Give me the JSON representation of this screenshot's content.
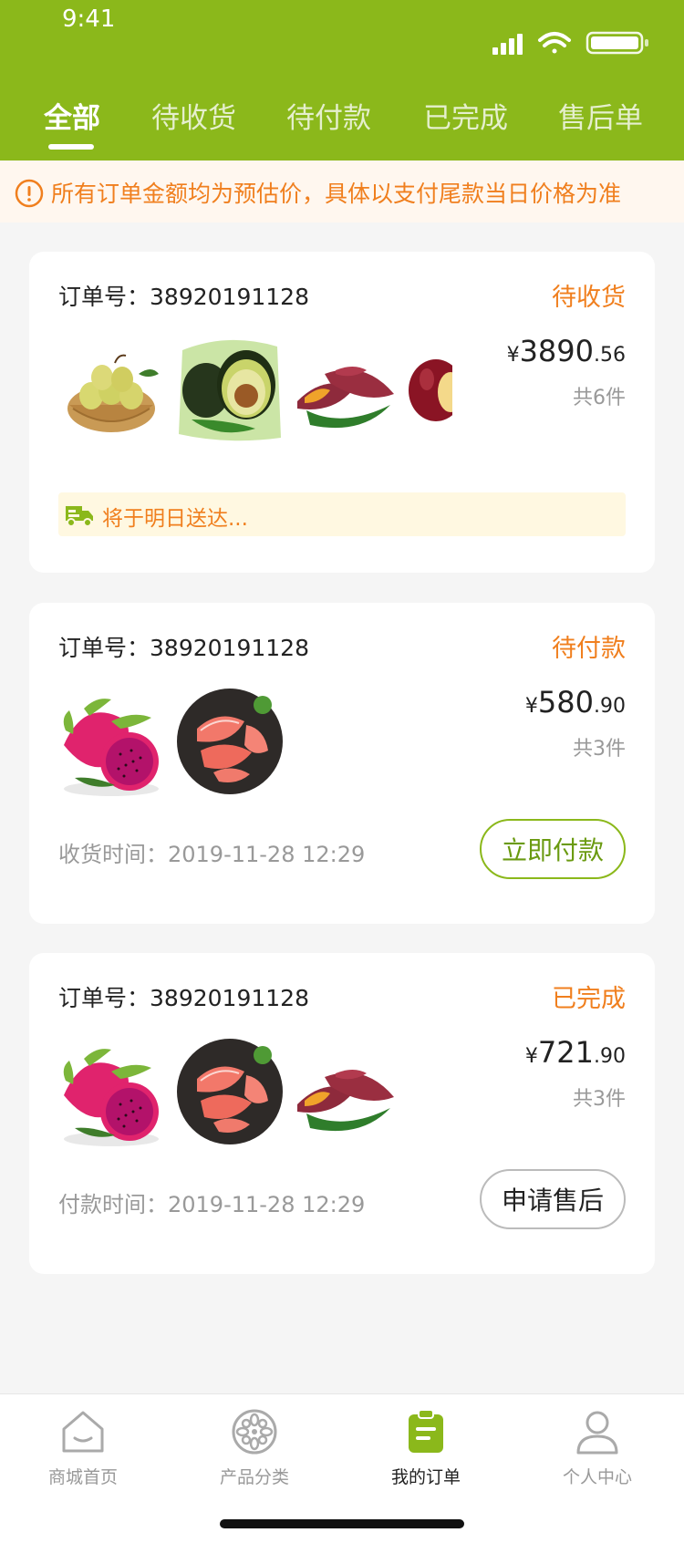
{
  "status_bar": {
    "time": "9:41"
  },
  "tabs": [
    {
      "label": "全部",
      "active": true
    },
    {
      "label": "待收货",
      "active": false
    },
    {
      "label": "待付款",
      "active": false
    },
    {
      "label": "已完成",
      "active": false
    },
    {
      "label": "售后单",
      "active": false
    }
  ],
  "notice": {
    "icon": "info-circle-icon",
    "text": "所有订单金额均为预估价，具体以支付尾款当日价格为准"
  },
  "orders": [
    {
      "order_label": "订单号：",
      "order_no": "38920191128",
      "status": "待收货",
      "products": [
        "pear-basket",
        "avocado",
        "sweet-potato",
        "apple"
      ],
      "price_symbol": "¥",
      "price_int": "3890",
      "price_dec": ".56",
      "count": "共6件",
      "delivery_note": "将于明日送达..."
    },
    {
      "order_label": "订单号：",
      "order_no": "38920191128",
      "status": "待付款",
      "products": [
        "dragon-fruit",
        "pomelo"
      ],
      "price_symbol": "¥",
      "price_int": "580",
      "price_dec": ".90",
      "count": "共3件",
      "time_text": "收货时间：2019-11-28   12:29",
      "action": "立即付款"
    },
    {
      "order_label": "订单号：",
      "order_no": "38920191128",
      "status": "已完成",
      "products": [
        "dragon-fruit",
        "pomelo",
        "sweet-potato"
      ],
      "price_symbol": "¥",
      "price_int": "721",
      "price_dec": ".90",
      "count": "共3件",
      "time_text": "付款时间：2019-11-28   12:29",
      "action": "申请售后"
    }
  ],
  "bottom_nav": [
    {
      "label": "商城首页",
      "icon": "home-icon",
      "active": false
    },
    {
      "label": "产品分类",
      "icon": "category-icon",
      "active": false
    },
    {
      "label": "我的订单",
      "icon": "order-clipboard-icon",
      "active": true
    },
    {
      "label": "个人中心",
      "icon": "user-icon",
      "active": false
    }
  ],
  "colors": {
    "primary": "#8bb81b",
    "accent": "#f07f1e",
    "background": "#f5f5f5"
  }
}
